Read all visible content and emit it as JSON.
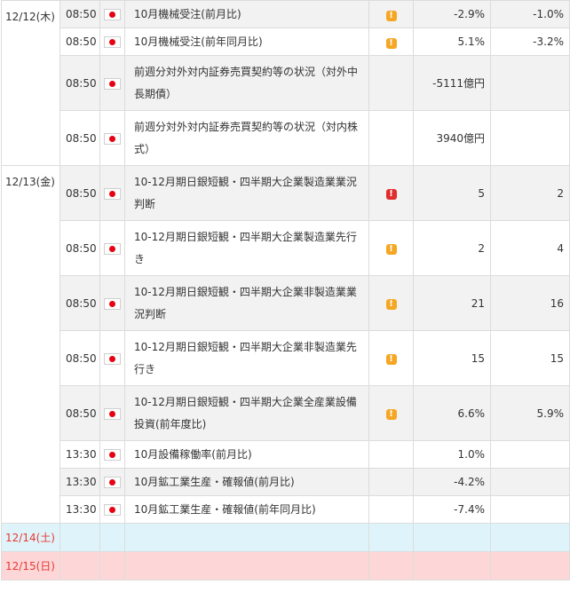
{
  "colors": {
    "flag_red": "#e60012",
    "importance_mid": "#f5a623",
    "importance_high": "#e02e2e",
    "weekend_text": "#e53935",
    "saturday_bg": "#dff4fa",
    "sunday_bg": "#fdd7d7",
    "row_alt_bg": "#f2f2f2"
  },
  "day1": {
    "date": "12/12(木)",
    "rows": [
      {
        "time": "08:50",
        "country_icon": "japan-flag-icon",
        "event": "10月機械受注(前月比)",
        "importance": "mid",
        "importance_glyph": "!",
        "actual": "-2.9%",
        "forecast": "-1.0%"
      },
      {
        "time": "08:50",
        "country_icon": "japan-flag-icon",
        "event": "10月機械受注(前年同月比)",
        "importance": "mid",
        "importance_glyph": "!",
        "actual": "5.1%",
        "forecast": "-3.2%"
      },
      {
        "time": "08:50",
        "country_icon": "japan-flag-icon",
        "event": "前週分対外対内証券売買契約等の状況（対外中長期債）",
        "importance": "",
        "importance_glyph": "",
        "actual": "-5111億円",
        "forecast": ""
      },
      {
        "time": "08:50",
        "country_icon": "japan-flag-icon",
        "event": "前週分対外対内証券売買契約等の状況（対内株式）",
        "importance": "",
        "importance_glyph": "",
        "actual": "3940億円",
        "forecast": ""
      }
    ]
  },
  "day2": {
    "date": "12/13(金)",
    "rows": [
      {
        "time": "08:50",
        "country_icon": "japan-flag-icon",
        "event": "10-12月期日銀短観・四半期大企業製造業業況判断",
        "importance": "high",
        "importance_glyph": "!",
        "actual": "5",
        "forecast": "2"
      },
      {
        "time": "08:50",
        "country_icon": "japan-flag-icon",
        "event": "10-12月期日銀短観・四半期大企業製造業先行き",
        "importance": "mid",
        "importance_glyph": "!",
        "actual": "2",
        "forecast": "4"
      },
      {
        "time": "08:50",
        "country_icon": "japan-flag-icon",
        "event": "10-12月期日銀短観・四半期大企業非製造業業況判断",
        "importance": "mid",
        "importance_glyph": "!",
        "actual": "21",
        "forecast": "16"
      },
      {
        "time": "08:50",
        "country_icon": "japan-flag-icon",
        "event": "10-12月期日銀短観・四半期大企業非製造業先行き",
        "importance": "mid",
        "importance_glyph": "!",
        "actual": "15",
        "forecast": "15"
      },
      {
        "time": "08:50",
        "country_icon": "japan-flag-icon",
        "event": "10-12月期日銀短観・四半期大企業全産業設備投資(前年度比)",
        "importance": "mid",
        "importance_glyph": "!",
        "actual": "6.6%",
        "forecast": "5.9%"
      },
      {
        "time": "13:30",
        "country_icon": "japan-flag-icon",
        "event": "10月設備稼働率(前月比)",
        "importance": "",
        "importance_glyph": "",
        "actual": "1.0%",
        "forecast": ""
      },
      {
        "time": "13:30",
        "country_icon": "japan-flag-icon",
        "event": "10月鉱工業生産・確報値(前月比)",
        "importance": "",
        "importance_glyph": "",
        "actual": "-4.2%",
        "forecast": ""
      },
      {
        "time": "13:30",
        "country_icon": "japan-flag-icon",
        "event": "10月鉱工業生産・確報値(前年同月比)",
        "importance": "",
        "importance_glyph": "",
        "actual": "-7.4%",
        "forecast": ""
      }
    ]
  },
  "day3": {
    "date": "12/14(土)"
  },
  "day4": {
    "date": "12/15(日)"
  }
}
